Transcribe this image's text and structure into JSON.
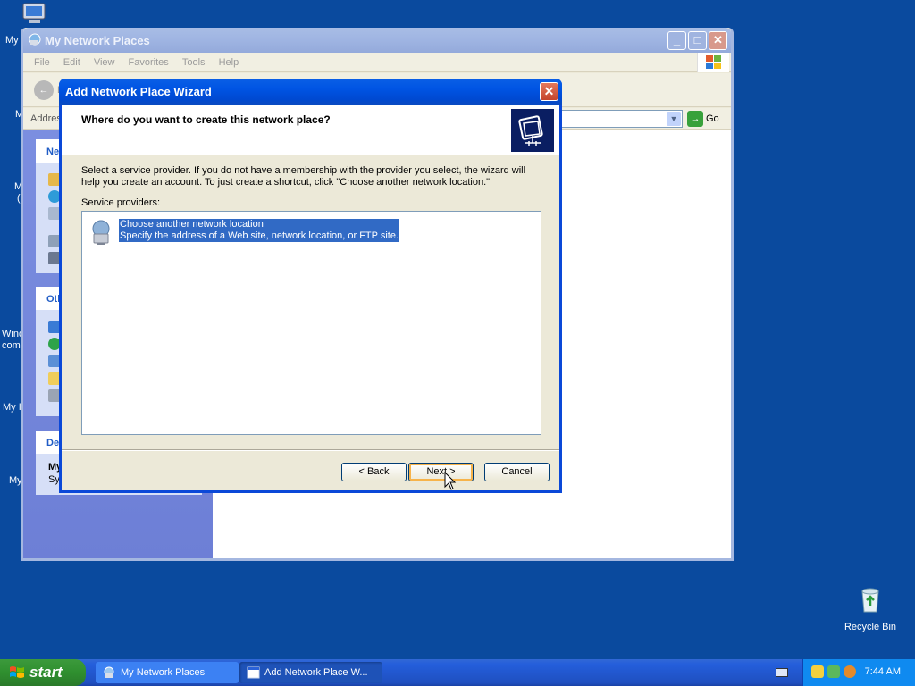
{
  "desktop": {
    "fragments": [
      "My",
      "M",
      "M",
      "(",
      "Wind",
      "com",
      "My I",
      "My"
    ],
    "recycle_bin": "Recycle Bin"
  },
  "explorer": {
    "title": "My Network Places",
    "menu": [
      "File",
      "Edit",
      "View",
      "Favorites",
      "Tools",
      "Help"
    ],
    "back_label": "B",
    "address_label": "Addres",
    "go_label": "Go",
    "panels": [
      {
        "head": "Ne"
      },
      {
        "head": "Oth"
      },
      {
        "head": "De",
        "detail_title": "My",
        "detail_sub": "Sys"
      }
    ]
  },
  "wizard": {
    "title": "Add Network Place Wizard",
    "heading": "Where do you want to create this network place?",
    "body": "Select a service provider.  If you do not have a membership with the provider you select, the wizard will help you create an account.  To just create a shortcut, click \"Choose another network location.\"",
    "list_label": "Service providers:",
    "provider": {
      "name": "Choose another network location",
      "description": "Specify the address of a Web site, network location, or FTP site."
    },
    "buttons": {
      "back": "< Back",
      "next": "Next >",
      "cancel": "Cancel"
    }
  },
  "taskbar": {
    "start": "start",
    "tasks": [
      {
        "label": "My Network Places"
      },
      {
        "label": "Add Network Place W..."
      }
    ],
    "clock": "7:44 AM"
  },
  "colors": {
    "desktop": "#0a4a9e",
    "wizard_title": "#0054e3",
    "selection": "#316ac5"
  }
}
